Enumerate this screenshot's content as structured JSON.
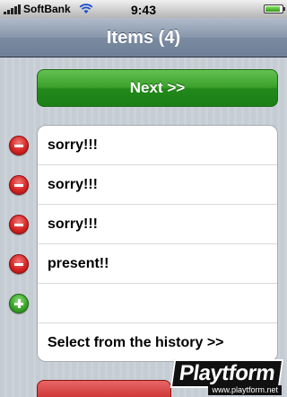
{
  "status_bar": {
    "carrier": "SoftBank",
    "time": "9:43",
    "signal_bars": 5,
    "battery_level": 0.9
  },
  "nav_bar": {
    "title": "Items (4)"
  },
  "actions": {
    "next_label": "Next  >>"
  },
  "items": [
    {
      "label": "sorry!!!",
      "icon": "minus-circle-icon"
    },
    {
      "label": "sorry!!!",
      "icon": "minus-circle-icon"
    },
    {
      "label": "sorry!!!",
      "icon": "minus-circle-icon"
    },
    {
      "label": "present!!",
      "icon": "minus-circle-icon"
    }
  ],
  "new_item": {
    "value": "",
    "icon": "plus-circle-icon"
  },
  "history": {
    "label": "Select from the history  >>"
  },
  "watermark": {
    "logo_text": "Playtform",
    "url": "www.playtform.net"
  },
  "colors": {
    "accent_green": "#22891a",
    "nav_blue": "#6d7f97",
    "delete_red": "#d62424",
    "add_green": "#3aa52a"
  }
}
